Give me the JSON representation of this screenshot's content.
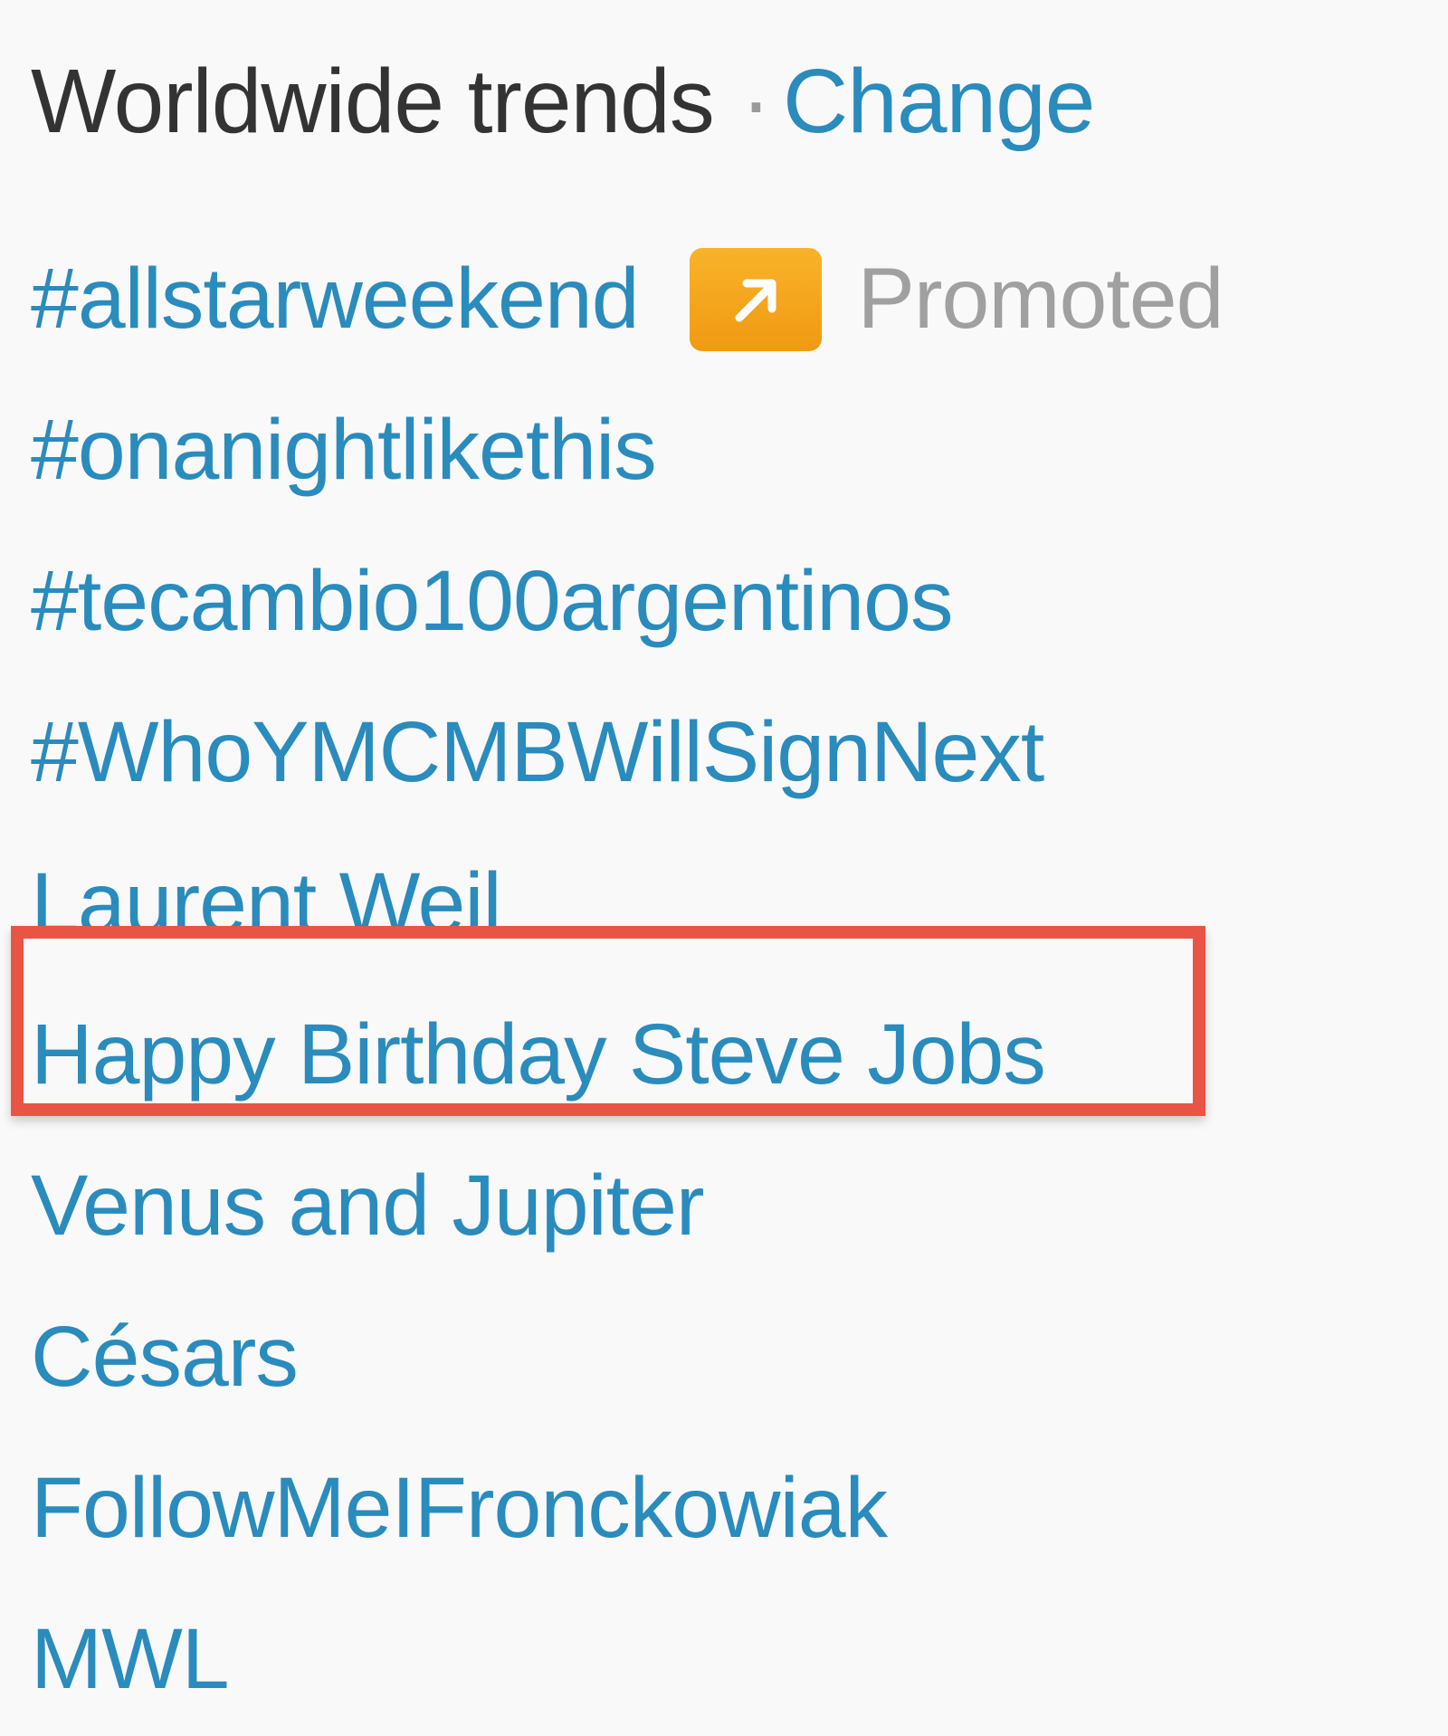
{
  "header": {
    "title": "Worldwide trends",
    "separator": "·",
    "change_label": "Change"
  },
  "trends": [
    {
      "label": "#allstarweekend",
      "promoted": true,
      "promoted_label": "Promoted"
    },
    {
      "label": "#onanightlikethis"
    },
    {
      "label": "#tecambio100argentinos"
    },
    {
      "label": "#WhoYMCMBWillSignNext"
    },
    {
      "label": "Laurent Weil"
    },
    {
      "label": "Happy Birthday Steve Jobs",
      "highlighted": true
    },
    {
      "label": "Venus and Jupiter"
    },
    {
      "label": "Césars"
    },
    {
      "label": "FollowMeIFronckowiak"
    },
    {
      "label": "MWL"
    }
  ],
  "icons": {
    "promoted": "arrow-up-right-icon"
  },
  "colors": {
    "background": "#f9f9f9",
    "title": "#333333",
    "link": "#2a8bbd",
    "promoted_badge": "#f5a623",
    "promoted_text": "#a0a0a0",
    "highlight": "#ea5446"
  }
}
